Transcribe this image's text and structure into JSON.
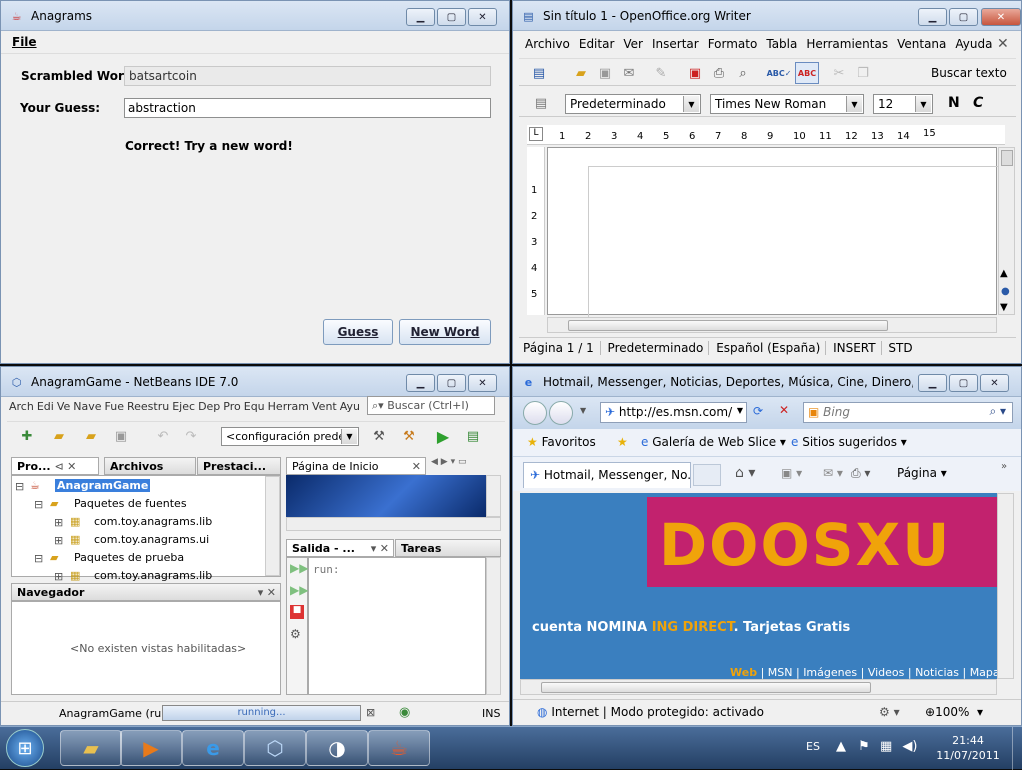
{
  "anagram": {
    "title": "Anagrams",
    "menu_file": "File",
    "scrambled_label": "Scrambled Word:",
    "scrambled_value": "batsartcoin",
    "guess_label": "Your Guess:",
    "guess_value": "abstraction",
    "feedback": "Correct! Try a new word!",
    "guess_button": "Guess",
    "new_word_button": "New Word"
  },
  "writer": {
    "title": "Sin título 1 - OpenOffice.org Writer",
    "menu": [
      "Archivo",
      "Editar",
      "Ver",
      "Insertar",
      "Formato",
      "Tabla",
      "Herramientas",
      "Ventana",
      "Ayuda"
    ],
    "find_text": "Buscar texto",
    "style": "Predeterminado",
    "font": "Times New Roman",
    "size": "12",
    "bold": "N",
    "italic": "C",
    "ruler": [
      "1",
      "2",
      "3",
      "4",
      "5",
      "6",
      "7",
      "8",
      "9",
      "10",
      "11",
      "12",
      "13",
      "14",
      "15"
    ],
    "vruler": [
      "1",
      "2",
      "3",
      "4",
      "5"
    ],
    "status": [
      "Página 1 / 1",
      "Predeterminado",
      "Español (España)",
      "INSERT",
      "STD"
    ]
  },
  "netbeans": {
    "title": "AnagramGame - NetBeans IDE 7.0",
    "menu": [
      "Arch",
      "Edi",
      "Ve",
      "Nave",
      "Fue",
      "Reestru",
      "Ejec",
      "Dep",
      "Pro",
      "Equ",
      "Herram",
      "Vent",
      "Ayu"
    ],
    "search_placeholder": "Buscar (Ctrl+I)",
    "config": "<configuración prede...",
    "tabs": [
      "Pro...",
      "Archivos",
      "Prestaci..."
    ],
    "tree": {
      "project": "AnagramGame",
      "src": "Paquetes de fuentes",
      "pkg1": "com.toy.anagrams.lib",
      "pkg2": "com.toy.anagrams.ui",
      "test": "Paquetes de prueba",
      "pkg3": "com.toy.anagrams.lib"
    },
    "start_tab": "Página de Inicio",
    "navigator": "Navegador",
    "navigator_empty": "<No existen vistas habilitadas>",
    "output_tab": "Salida - ...",
    "tasks_tab": "Tareas",
    "output_text": "run:",
    "status_run": "AnagramGame (run)",
    "progress_text": "running...",
    "ins": "INS"
  },
  "ie": {
    "title": "Hotmail, Messenger, Noticias, Deportes, Música, Cine, Dinero, Motor...",
    "url": "http://es.msn.com/",
    "search": "Bing",
    "favorites": "Favoritos",
    "fav1": "Galería de Web Slice",
    "fav2": "Sitios sugeridos",
    "tab": "Hotmail, Messenger, No...",
    "page_menu": "Página",
    "banner": "DOOSXU",
    "ad_text_1": "cuenta NOMINA ",
    "ad_text_2": "ING DIRECT",
    "ad_text_3": ". Tarjetas Gratis",
    "links": [
      "Web",
      "MSN",
      "Imágenes",
      "Videos",
      "Noticias",
      "Mapas"
    ],
    "status": "Internet | Modo protegido: activado",
    "zoom": "100%"
  },
  "taskbar": {
    "lang": "ES",
    "time": "21:44",
    "date": "11/07/2011"
  },
  "colors": {
    "title_bar": "#c4d5ea",
    "msn_blue": "#3a7fbf",
    "banner_pink": "#c2226e",
    "banner_orange": "#f0a30a"
  }
}
